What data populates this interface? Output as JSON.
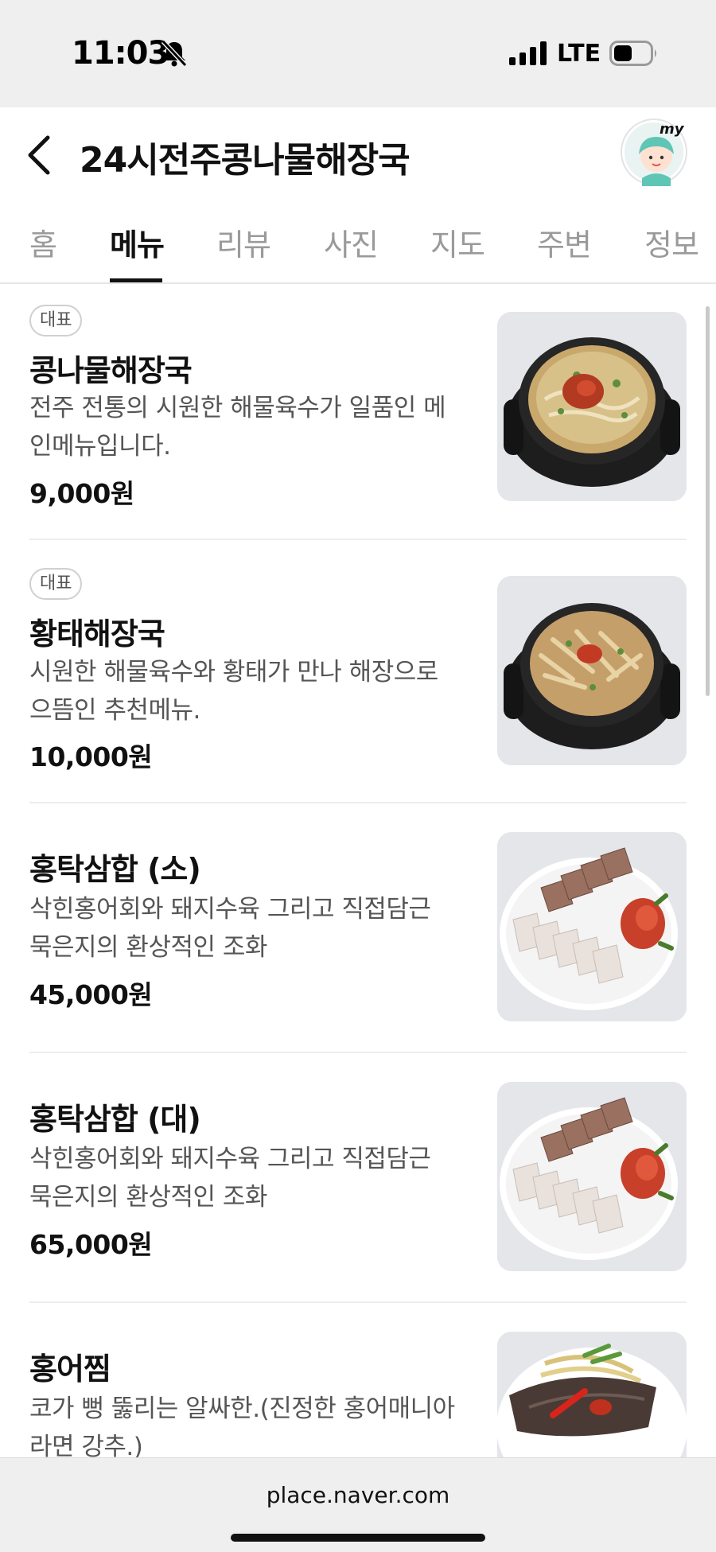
{
  "status_bar": {
    "time": "11:03",
    "network": "LTE",
    "icons": [
      "bell-slash-icon",
      "signal-icon",
      "battery-icon"
    ]
  },
  "header": {
    "title": "24시전주콩나물해장국",
    "back_icon": "chevron-left-icon",
    "avatar_label": "my"
  },
  "tabs": [
    {
      "label": "홈",
      "active": false
    },
    {
      "label": "메뉴",
      "active": true
    },
    {
      "label": "리뷰",
      "active": false
    },
    {
      "label": "사진",
      "active": false
    },
    {
      "label": "지도",
      "active": false
    },
    {
      "label": "주변",
      "active": false
    },
    {
      "label": "정보",
      "active": false
    }
  ],
  "menu": [
    {
      "badge": "대표",
      "name": "콩나물해장국",
      "desc_line1": "전주 전통의 시원한 해물육수가 일품인 메",
      "desc_line2": "인메뉴입니다.",
      "price": "9,000원",
      "photo": "bean-sprout-soup-photo"
    },
    {
      "badge": "대표",
      "name": "황태해장국",
      "desc_line1": "시원한 해물육수와 황태가 만나 해장으로",
      "desc_line2": "으뜸인 추천메뉴.",
      "price": "10,000원",
      "photo": "pollack-soup-photo"
    },
    {
      "badge": "",
      "name": "홍탁삼합 (소)",
      "desc_line1": "삭힌홍어회와 돼지수육 그리고 직접담근",
      "desc_line2": "묵은지의 환상적인 조화",
      "price": "45,000원",
      "photo": "samhap-platter-photo"
    },
    {
      "badge": "",
      "name": "홍탁삼합 (대)",
      "desc_line1": "삭힌홍어회와 돼지수육 그리고 직접담근",
      "desc_line2": "묵은지의 환상적인 조화",
      "price": "65,000원",
      "photo": "samhap-platter-photo"
    },
    {
      "badge": "",
      "name": "홍어찜",
      "desc_line1": "코가 뻥 뚫리는 알싸한.(진정한 홍어매니아",
      "desc_line2": "라면 강추.)",
      "price": "",
      "photo": "steamed-skate-photo"
    }
  ],
  "url_bar": {
    "url": "place.naver.com"
  },
  "colors": {
    "status_bg": "#efefef",
    "tab_inactive": "#9a9a9a",
    "text_primary": "#111111",
    "text_secondary": "#555555",
    "divider": "#ededed",
    "photo_bg": "#e4e6ea"
  }
}
